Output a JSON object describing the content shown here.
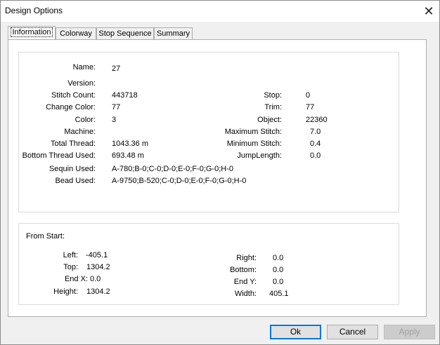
{
  "window": {
    "title": "Design Options",
    "close_glyph": "✕"
  },
  "tabs": [
    "Information",
    "Colorway",
    "Stop Sequence",
    "Summary"
  ],
  "info": {
    "name_label": "Name:",
    "name": "27",
    "version_label": "Version:",
    "version": "",
    "stitch_count_label": "Stitch Count:",
    "stitch_count": "443718",
    "change_color_label": "Change Color:",
    "change_color": "77",
    "color_label": "Color:",
    "color": "3",
    "machine_label": "Machine:",
    "machine": "",
    "total_thread_label": "Total Thread:",
    "total_thread": "1043.36 m",
    "bottom_thread_label": "Bottom Thread Used:",
    "bottom_thread": "693.48 m",
    "sequin_label": "Sequin Used:",
    "sequin": "A-780;B-0;C-0;D-0;E-0;F-0;G-0;H-0",
    "bead_label": "Bead Used:",
    "bead": "A-9750;B-520;C-0;D-0;E-0;F-0;G-0;H-0",
    "stop_label": "Stop:",
    "stop": "0",
    "trim_label": "Trim:",
    "trim": "77",
    "object_label": "Object:",
    "object": "22360",
    "max_stitch_label": "Maximum Stitch:",
    "max_stitch": "7.0",
    "min_stitch_label": "Minimum Stitch:",
    "min_stitch": "0.4",
    "jump_length_label": "JumpLength:",
    "jump_length": "0.0"
  },
  "from_start": {
    "heading": "From Start:",
    "left_label": "Left:",
    "left": "-405.1",
    "top_label": "Top:",
    "top": "1304.2",
    "endx_label": "End X:",
    "endx": "0.0",
    "height_label": "Height:",
    "height": "1304.2",
    "right_label": "Right:",
    "right": "0.0",
    "bottom_label": "Bottom:",
    "bottom": "0.0",
    "endy_label": "End Y:",
    "endy": "0.0",
    "width_label": "Width:",
    "width": "405.1"
  },
  "buttons": {
    "ok": "Ok",
    "cancel": "Cancel",
    "apply": "Apply"
  }
}
